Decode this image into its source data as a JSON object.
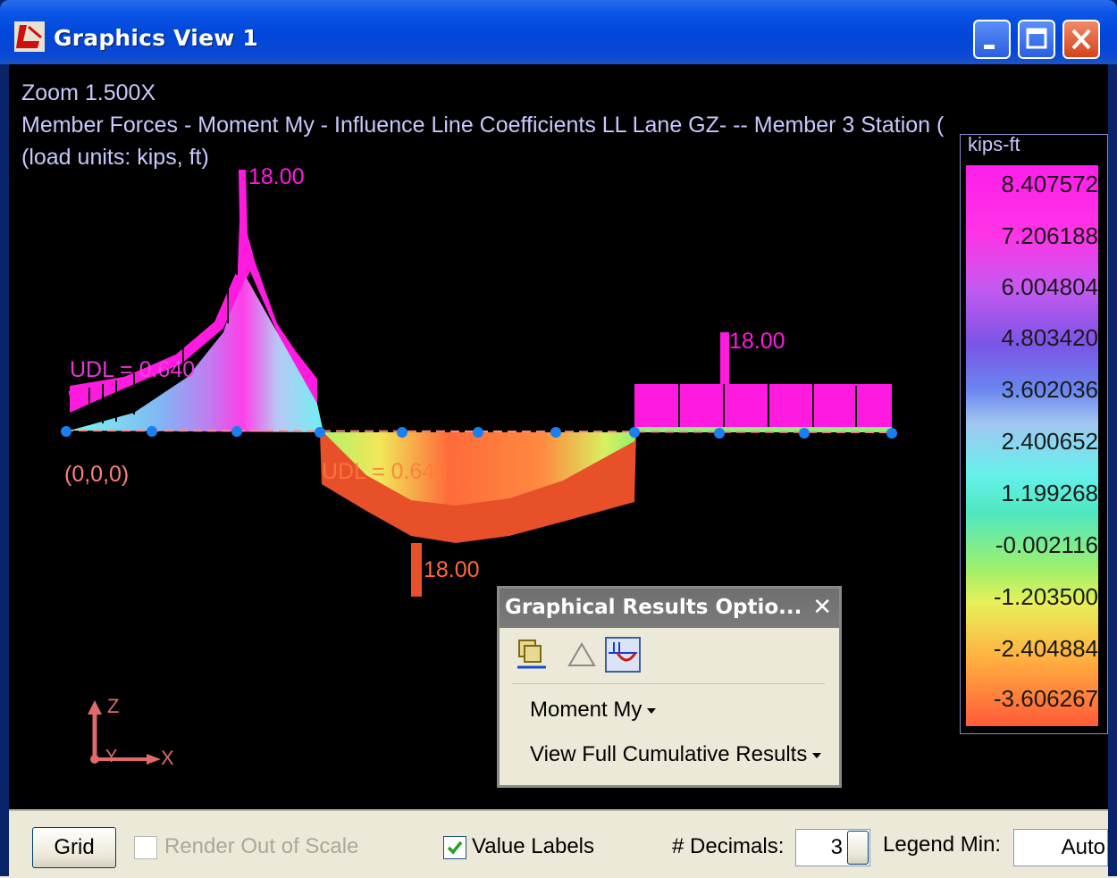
{
  "window": {
    "title": "Graphics View 1",
    "controls": {
      "minimize": "minimize",
      "maximize": "maximize",
      "close": "close"
    }
  },
  "view": {
    "zoom": "Zoom  1.500X",
    "description": "Member Forces - Moment My - Influence Line Coefficients LL Lane GZ- -- Member 3 Station (",
    "units": " (load units: kips, ft)",
    "origin_label": "(0,0,0)",
    "load_labels": {
      "top_left": "18.00",
      "top_right": "18.00",
      "bottom": "18.00",
      "udl_left": "UDL = 0.640",
      "udl_mid": "UDL = 0.640"
    },
    "axes": {
      "z": "Z",
      "y": "Y",
      "x": "X"
    }
  },
  "legend": {
    "unit": "kips-ft",
    "values": [
      "8.407572",
      "7.206188",
      "6.004804",
      "4.803420",
      "3.602036",
      "2.400652",
      "1.199268",
      "-0.002116",
      "-1.203500",
      "-2.404884",
      "-3.606267"
    ],
    "colors": [
      "#ff1eea",
      "#ff3ae0",
      "#b55cf0",
      "#7e52e6",
      "#6f90ee",
      "#a6cbf1",
      "#6cf2ec",
      "#52e6b9",
      "#99ef6a",
      "#ffd050",
      "#ff5a38"
    ]
  },
  "panel": {
    "title": "Graphical Results Optio...",
    "tools": [
      "copy-icon",
      "triangle-icon",
      "influence-line-icon"
    ],
    "result_type": "Moment My",
    "result_mode": "View Full Cumulative Results"
  },
  "bottom": {
    "grid_button": "Grid",
    "render_out_of_scale": "Render Out of Scale",
    "render_out_of_scale_checked": false,
    "value_labels": "Value Labels",
    "value_labels_checked": true,
    "decimals_label": "# Decimals:",
    "decimals_value": "3",
    "legend_min_label": "Legend Min:",
    "legend_min_value": "Auto"
  }
}
